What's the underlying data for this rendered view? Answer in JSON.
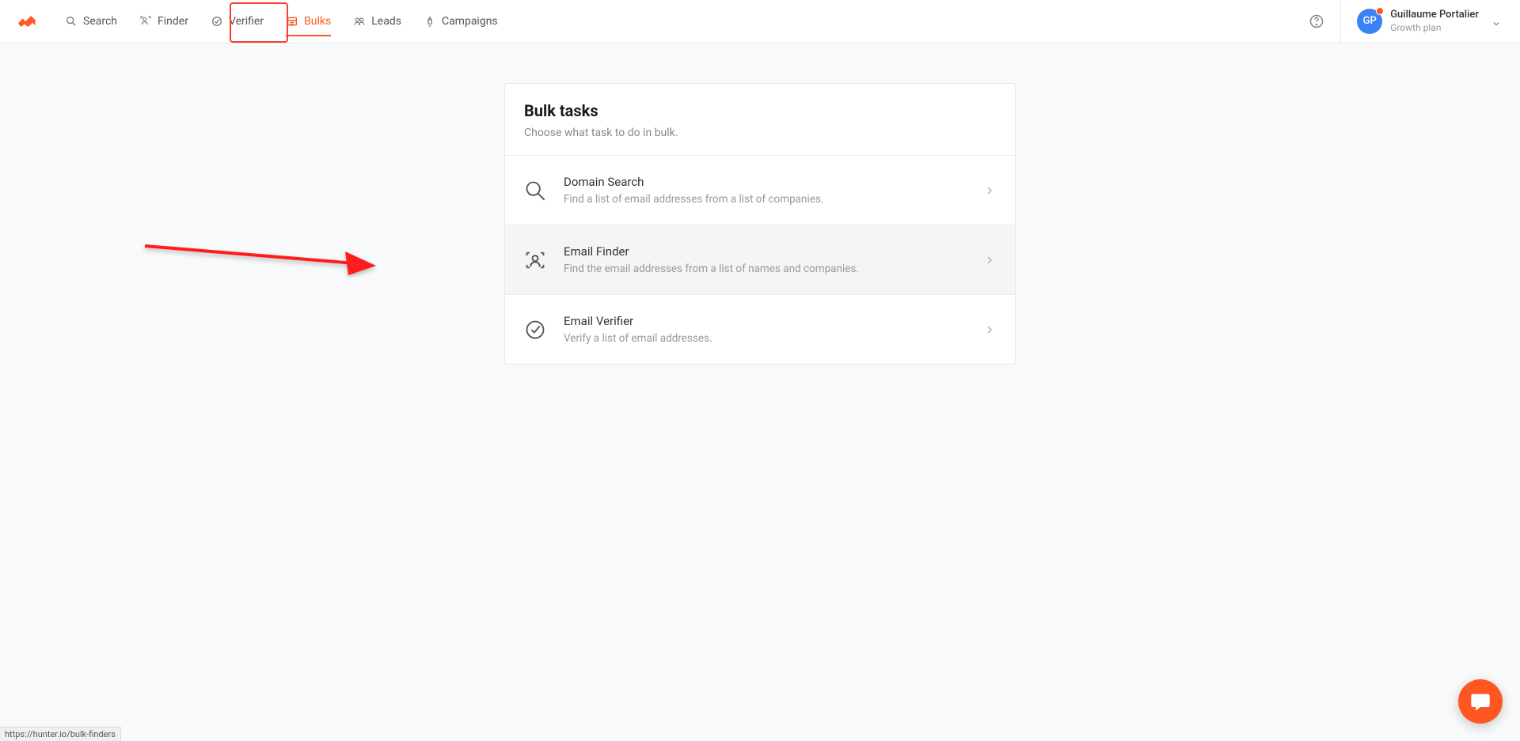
{
  "nav": {
    "items": [
      {
        "label": "Search"
      },
      {
        "label": "Finder"
      },
      {
        "label": "Verifier"
      },
      {
        "label": "Bulks"
      },
      {
        "label": "Leads"
      },
      {
        "label": "Campaigns"
      }
    ]
  },
  "user": {
    "initials": "GP",
    "name": "Guillaume Portalier",
    "plan": "Growth plan"
  },
  "panel": {
    "title": "Bulk tasks",
    "subtitle": "Choose what task to do in bulk."
  },
  "tasks": [
    {
      "title": "Domain Search",
      "desc": "Find a list of email addresses from a list of companies."
    },
    {
      "title": "Email Finder",
      "desc": "Find the email addresses from a list of names and companies."
    },
    {
      "title": "Email Verifier",
      "desc": "Verify a list of email addresses."
    }
  ],
  "url_hint": "https://hunter.io/bulk-finders"
}
